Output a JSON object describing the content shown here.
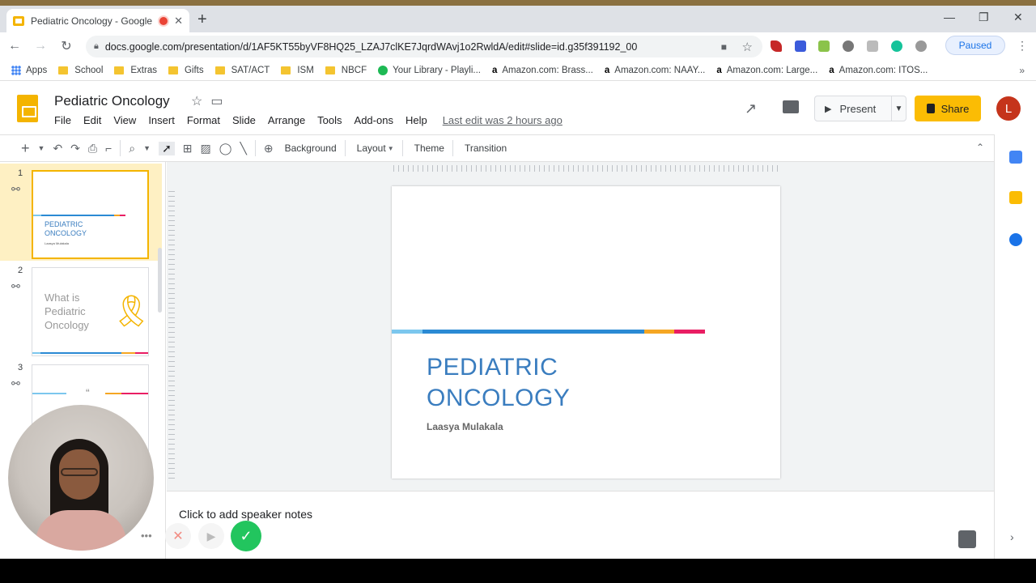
{
  "browser": {
    "tab_title": "Pediatric Oncology - Google",
    "url": "docs.google.com/presentation/d/1AF5KT55byVF8HQ25_LZAJ7clKE7JqrdWAvj1o2RwldA/edit#slide=id.g35f391192_00",
    "profile_status": "Paused",
    "bookmarks": [
      {
        "label": "Apps",
        "icon": "apps-icon"
      },
      {
        "label": "School",
        "icon": "folder-icon"
      },
      {
        "label": "Extras",
        "icon": "folder-icon"
      },
      {
        "label": "Gifts",
        "icon": "folder-icon"
      },
      {
        "label": "SAT/ACT",
        "icon": "folder-icon"
      },
      {
        "label": "ISM",
        "icon": "folder-icon"
      },
      {
        "label": "NBCF",
        "icon": "folder-icon"
      },
      {
        "label": "Your Library - Playli...",
        "icon": "spotify-icon"
      },
      {
        "label": "Amazon.com: Brass...",
        "icon": "amazon-icon"
      },
      {
        "label": "Amazon.com: NAAY...",
        "icon": "amazon-icon"
      },
      {
        "label": "Amazon.com: Large...",
        "icon": "amazon-icon"
      },
      {
        "label": "Amazon.com: ITOS...",
        "icon": "amazon-icon"
      }
    ]
  },
  "app": {
    "doc_title": "Pediatric Oncology",
    "menu": [
      "File",
      "Edit",
      "View",
      "Insert",
      "Format",
      "Slide",
      "Arrange",
      "Tools",
      "Add-ons",
      "Help"
    ],
    "last_edit": "Last edit was 2 hours ago",
    "present_label": "Present",
    "share_label": "Share",
    "avatar_letter": "L",
    "accent_color": "#fbbc04"
  },
  "toolbar": {
    "background": "Background",
    "layout": "Layout",
    "theme": "Theme",
    "transition": "Transition"
  },
  "slides": {
    "s1": {
      "num": "1",
      "title_line1": "PEDIATRIC",
      "title_line2": "ONCOLOGY",
      "subtitle": "Laasya Mulakala"
    },
    "s2": {
      "num": "2",
      "title_line1": "What is",
      "title_line2": "Pediatric",
      "title_line3": "Oncology"
    },
    "s3": {
      "num": "3",
      "quote": "“"
    }
  },
  "current_slide": {
    "title_line1": "PEDIATRIC",
    "title_line2": "ONCOLOGY",
    "subtitle": "Laasya Mulakala"
  },
  "notes": {
    "placeholder": "Click to add speaker notes"
  }
}
